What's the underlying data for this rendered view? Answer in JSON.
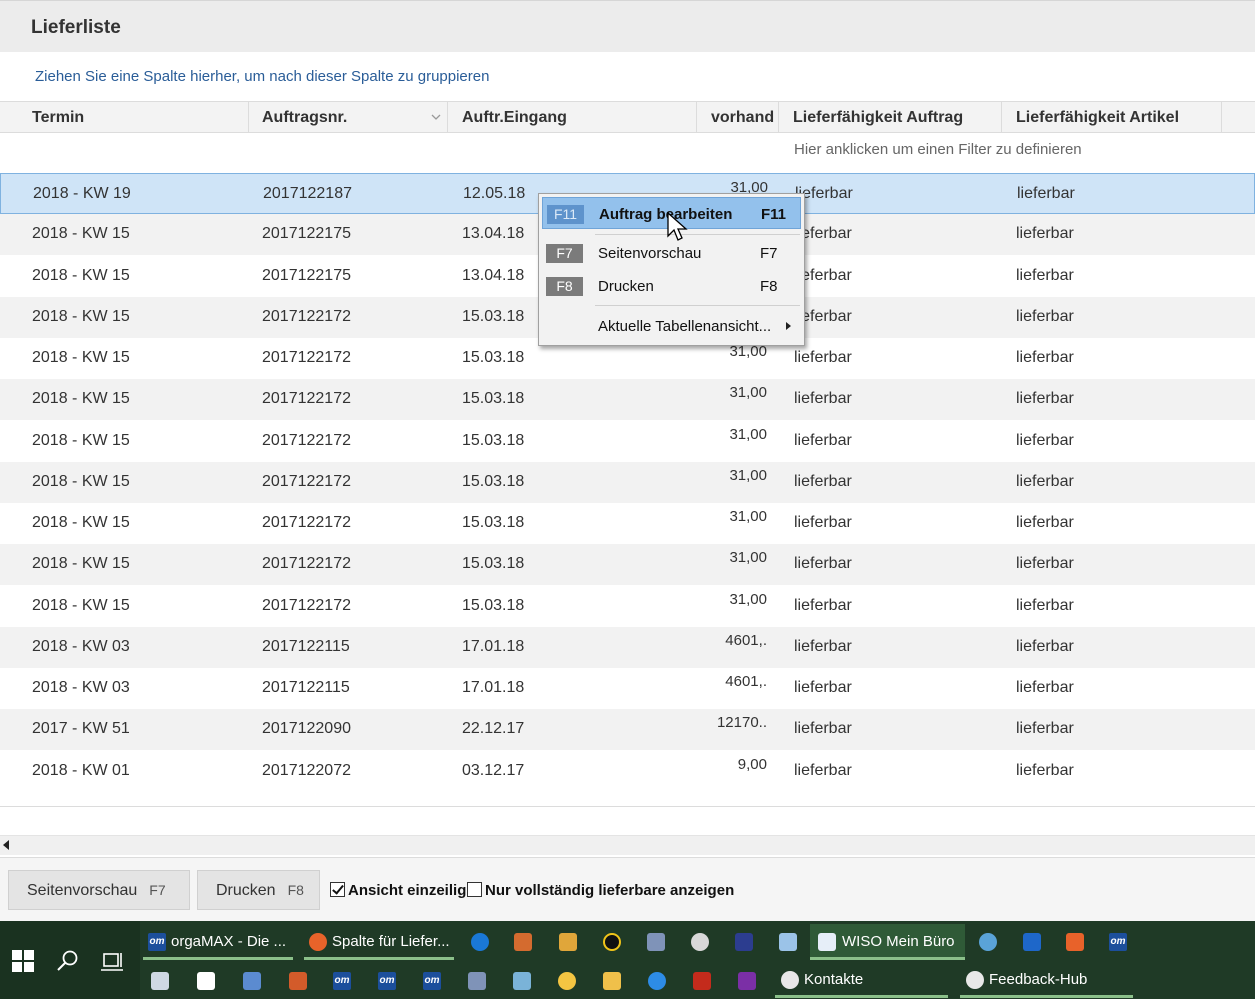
{
  "window": {
    "title": "Lieferliste"
  },
  "group_hint": "Ziehen Sie eine Spalte hierher, um nach dieser Spalte zu gruppieren",
  "columns": [
    "Termin",
    "Auftragsnr.",
    "Auftr.Eingang",
    "vorhand",
    "Lieferfähigkeit Auftrag",
    "Lieferfähigkeit Artikel"
  ],
  "filter_hint": "Hier anklicken um einen Filter zu definieren",
  "rows": [
    {
      "termin": "2018 - KW 19",
      "auftragsnr": "2017122187",
      "eingang": "12.05.18",
      "vorhand": "31,00",
      "lf_auftrag": "lieferbar",
      "lf_artikel": "lieferbar"
    },
    {
      "termin": "2018 - KW 15",
      "auftragsnr": "2017122175",
      "eingang": "13.04.18",
      "vorhand": "",
      "lf_auftrag": "lieferbar",
      "lf_artikel": "lieferbar"
    },
    {
      "termin": "2018 - KW 15",
      "auftragsnr": "2017122175",
      "eingang": "13.04.18",
      "vorhand": "",
      "lf_auftrag": "lieferbar",
      "lf_artikel": "lieferbar"
    },
    {
      "termin": "2018 - KW 15",
      "auftragsnr": "2017122172",
      "eingang": "15.03.18",
      "vorhand": "",
      "lf_auftrag": "lieferbar",
      "lf_artikel": "lieferbar"
    },
    {
      "termin": "2018 - KW 15",
      "auftragsnr": "2017122172",
      "eingang": "15.03.18",
      "vorhand": "31,00",
      "lf_auftrag": "lieferbar",
      "lf_artikel": "lieferbar"
    },
    {
      "termin": "2018 - KW 15",
      "auftragsnr": "2017122172",
      "eingang": "15.03.18",
      "vorhand": "31,00",
      "lf_auftrag": "lieferbar",
      "lf_artikel": "lieferbar"
    },
    {
      "termin": "2018 - KW 15",
      "auftragsnr": "2017122172",
      "eingang": "15.03.18",
      "vorhand": "31,00",
      "lf_auftrag": "lieferbar",
      "lf_artikel": "lieferbar"
    },
    {
      "termin": "2018 - KW 15",
      "auftragsnr": "2017122172",
      "eingang": "15.03.18",
      "vorhand": "31,00",
      "lf_auftrag": "lieferbar",
      "lf_artikel": "lieferbar"
    },
    {
      "termin": "2018 - KW 15",
      "auftragsnr": "2017122172",
      "eingang": "15.03.18",
      "vorhand": "31,00",
      "lf_auftrag": "lieferbar",
      "lf_artikel": "lieferbar"
    },
    {
      "termin": "2018 - KW 15",
      "auftragsnr": "2017122172",
      "eingang": "15.03.18",
      "vorhand": "31,00",
      "lf_auftrag": "lieferbar",
      "lf_artikel": "lieferbar"
    },
    {
      "termin": "2018 - KW 15",
      "auftragsnr": "2017122172",
      "eingang": "15.03.18",
      "vorhand": "31,00",
      "lf_auftrag": "lieferbar",
      "lf_artikel": "lieferbar"
    },
    {
      "termin": "2018 - KW 03",
      "auftragsnr": "2017122115",
      "eingang": "17.01.18",
      "vorhand": "4601,.",
      "lf_auftrag": "lieferbar",
      "lf_artikel": "lieferbar"
    },
    {
      "termin": "2018 - KW 03",
      "auftragsnr": "2017122115",
      "eingang": "17.01.18",
      "vorhand": "4601,.",
      "lf_auftrag": "lieferbar",
      "lf_artikel": "lieferbar"
    },
    {
      "termin": "2017 - KW 51",
      "auftragsnr": "2017122090",
      "eingang": "22.12.17",
      "vorhand": "12170..",
      "lf_auftrag": "lieferbar",
      "lf_artikel": "lieferbar"
    },
    {
      "termin": "2018 - KW 01",
      "auftragsnr": "2017122072",
      "eingang": "03.12.17",
      "vorhand": "9,00",
      "lf_auftrag": "lieferbar",
      "lf_artikel": "lieferbar"
    }
  ],
  "context_menu": {
    "items": [
      {
        "badge": "F11",
        "label": "Auftrag bearbeiten",
        "shortcut": "F11"
      },
      {
        "badge": "F7",
        "label": "Seitenvorschau",
        "shortcut": "F7"
      },
      {
        "badge": "F8",
        "label": "Drucken",
        "shortcut": "F8"
      },
      {
        "badge": "",
        "label": "Aktuelle Tabellenansicht...",
        "shortcut": ""
      }
    ]
  },
  "bottom": {
    "preview_label": "Seitenvorschau",
    "preview_key": "F7",
    "print_label": "Drucken",
    "print_key": "F8",
    "check_single_line": "Ansicht einzeilig",
    "check_single_line_checked": true,
    "check_only_complete": "Nur vollständig lieferbare anzeigen",
    "check_only_complete_checked": false
  },
  "taskbar": {
    "apps_row1": [
      "orgaMAX - Die ...",
      "Spalte für Liefer...",
      "WISO Mein Büro"
    ],
    "apps_row2": [
      "Kontakte",
      "Feedback-Hub"
    ]
  },
  "colors": {
    "selection": "#cfe4f7",
    "menu_highlight": "#93c1ec",
    "link": "#2a5d98",
    "taskbar": "#1f3a26"
  }
}
